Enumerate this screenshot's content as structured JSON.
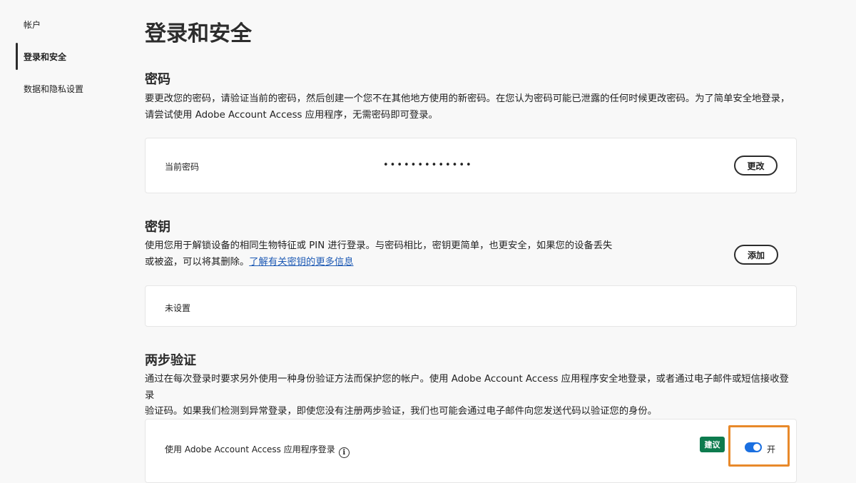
{
  "sidebar": {
    "items": [
      {
        "label": "帐户"
      },
      {
        "label": "登录和安全"
      },
      {
        "label": "数据和隐私设置"
      }
    ]
  },
  "page": {
    "title": "登录和安全"
  },
  "password": {
    "title": "密码",
    "desc_line1": "要更改您的密码，请验证当前的密码，然后创建一个您不在其他地方使用的新密码。在您认为密码可能已泄露的任何时候更改密码。为了简单安全地登录，",
    "desc_line2": "请尝试使用 Adobe Account Access 应用程序，无需密码即可登录。",
    "current_label": "当前密码",
    "masked_value": "•••••••••••••",
    "change_button": "更改"
  },
  "passkey": {
    "title": "密钥",
    "desc_line1": "使用您用于解锁设备的相同生物特征或 PIN 进行登录。与密码相比，密钥更简单，也更安全，如果您的设备丢失",
    "desc_line2": "或被盗，可以将其删除。",
    "learn_more_link": "了解有关密钥的更多信息",
    "add_button": "添加",
    "status": "未设置"
  },
  "two_step": {
    "title": "两步验证",
    "desc_line1": "通过在每次登录时要求另外使用一种身份验证方法而保护您的帐户。使用 Adobe Account Access 应用程序安全地登录，或者通过电子邮件或短信接收登录",
    "desc_line2": "验证码。如果我们检测到异常登录，即使您没有注册两步验证，我们也可能会通过电子邮件向您发送代码以验证您的身份。",
    "app_login_label": "使用 Adobe Account Access 应用程序登录",
    "info_icon_glyph": "i",
    "recommended_badge": "建议",
    "toggle_state": "开",
    "toggle_on": true
  },
  "colors": {
    "badge": "#0d7b4e",
    "toggle": "#1a6fe0",
    "highlight": "#e8892a",
    "link": "#1f5bb5"
  }
}
